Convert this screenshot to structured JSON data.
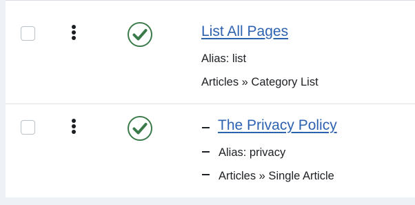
{
  "rows": [
    {
      "title": "List All Pages",
      "alias": "Alias: list",
      "type": "Articles » Category List",
      "level_marker": "",
      "status": "published",
      "checked": false
    },
    {
      "title": "The Privacy Policy",
      "alias": "Alias: privacy",
      "type": "Articles » Single Article",
      "level_marker": "–",
      "status": "published",
      "checked": false
    }
  ],
  "icons": {
    "drag": "vertical-ellipsis-icon",
    "status": "check-circle-icon"
  },
  "colors": {
    "link": "#2d62b0",
    "published": "#3a7a4a",
    "text": "#1c1f23",
    "background": "#eef1f6"
  }
}
